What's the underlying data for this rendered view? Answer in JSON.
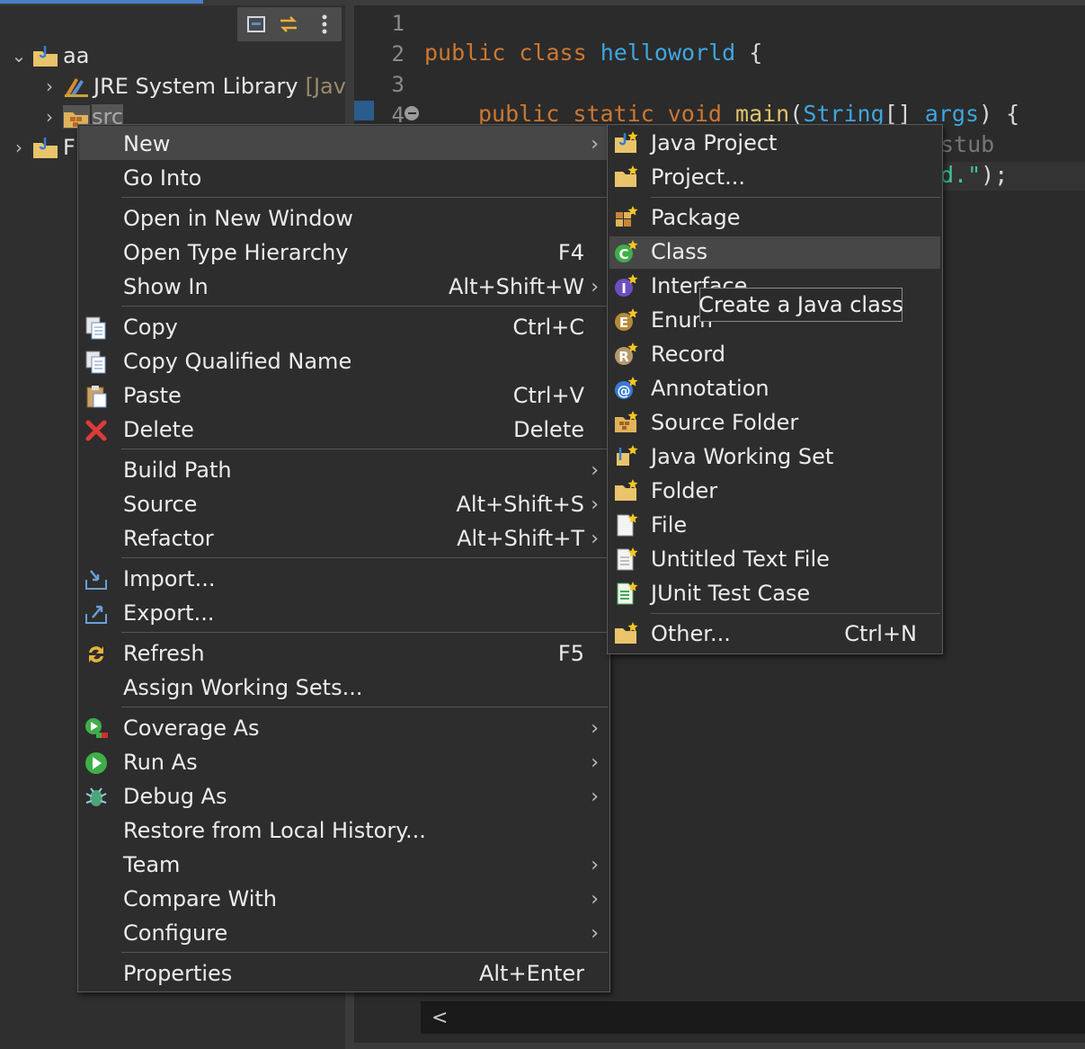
{
  "explorer": {
    "tree": [
      {
        "label": "aa",
        "expanded": true
      },
      {
        "label": "JRE System Library",
        "suffix": "[Java"
      },
      {
        "label": "src"
      },
      {
        "label": "F"
      }
    ]
  },
  "editor": {
    "line_numbers": [
      "1",
      "2",
      "3",
      "4"
    ],
    "code": {
      "l2_kw1": "public",
      "l2_kw2": "class",
      "l2_name": "helloworld",
      "l2_brace": "{",
      "l4_kw1": "public",
      "l4_kw2": "static",
      "l4_kw3": "void",
      "l4_fn": "main",
      "l4_paren": "(",
      "l4_type": "String",
      "l4_arr": "[]",
      "l4_arg": "args",
      "l4_end": ") {",
      "l5_tail": "stub",
      "l6_str": "d.\"",
      "l6_end": ");"
    },
    "hscroll_arrow": "<"
  },
  "context_menu": {
    "items": [
      {
        "label": "New",
        "shortcut": "",
        "submenu": true,
        "icon": ""
      },
      {
        "label": "Go Into",
        "shortcut": "",
        "submenu": false,
        "icon": ""
      },
      {
        "label": "Open in New Window",
        "shortcut": "",
        "submenu": false,
        "icon": ""
      },
      {
        "label": "Open Type Hierarchy",
        "shortcut": "F4",
        "submenu": false,
        "icon": ""
      },
      {
        "label": "Show In",
        "shortcut": "Alt+Shift+W",
        "submenu": true,
        "icon": ""
      },
      {
        "label": "Copy",
        "shortcut": "Ctrl+C",
        "submenu": false,
        "icon": "copy-icon"
      },
      {
        "label": "Copy Qualified Name",
        "shortcut": "",
        "submenu": false,
        "icon": "copy-qualified-icon"
      },
      {
        "label": "Paste",
        "shortcut": "Ctrl+V",
        "submenu": false,
        "icon": "paste-icon"
      },
      {
        "label": "Delete",
        "shortcut": "Delete",
        "submenu": false,
        "icon": "delete-icon"
      },
      {
        "label": "Build Path",
        "shortcut": "",
        "submenu": true,
        "icon": ""
      },
      {
        "label": "Source",
        "shortcut": "Alt+Shift+S",
        "submenu": true,
        "icon": ""
      },
      {
        "label": "Refactor",
        "shortcut": "Alt+Shift+T",
        "submenu": true,
        "icon": ""
      },
      {
        "label": "Import...",
        "shortcut": "",
        "submenu": false,
        "icon": "import-icon"
      },
      {
        "label": "Export...",
        "shortcut": "",
        "submenu": false,
        "icon": "export-icon"
      },
      {
        "label": "Refresh",
        "shortcut": "F5",
        "submenu": false,
        "icon": "refresh-icon"
      },
      {
        "label": "Assign Working Sets...",
        "shortcut": "",
        "submenu": false,
        "icon": ""
      },
      {
        "label": "Coverage As",
        "shortcut": "",
        "submenu": true,
        "icon": "coverage-icon"
      },
      {
        "label": "Run As",
        "shortcut": "",
        "submenu": true,
        "icon": "run-icon"
      },
      {
        "label": "Debug As",
        "shortcut": "",
        "submenu": true,
        "icon": "debug-icon"
      },
      {
        "label": "Restore from Local History...",
        "shortcut": "",
        "submenu": false,
        "icon": ""
      },
      {
        "label": "Team",
        "shortcut": "",
        "submenu": true,
        "icon": ""
      },
      {
        "label": "Compare With",
        "shortcut": "",
        "submenu": true,
        "icon": ""
      },
      {
        "label": "Configure",
        "shortcut": "",
        "submenu": true,
        "icon": ""
      },
      {
        "label": "Properties",
        "shortcut": "Alt+Enter",
        "submenu": false,
        "icon": ""
      }
    ]
  },
  "new_submenu": {
    "items": [
      {
        "label": "Java Project",
        "shortcut": "",
        "icon": "java-project-icon"
      },
      {
        "label": "Project...",
        "shortcut": "",
        "icon": "project-icon"
      },
      {
        "label": "Package",
        "shortcut": "",
        "icon": "package-icon"
      },
      {
        "label": "Class",
        "shortcut": "",
        "icon": "class-icon"
      },
      {
        "label": "Interface",
        "shortcut": "",
        "icon": "interface-icon"
      },
      {
        "label": "Enum",
        "shortcut": "",
        "icon": "enum-icon"
      },
      {
        "label": "Record",
        "shortcut": "",
        "icon": "record-icon"
      },
      {
        "label": "Annotation",
        "shortcut": "",
        "icon": "annotation-icon"
      },
      {
        "label": "Source Folder",
        "shortcut": "",
        "icon": "source-folder-icon"
      },
      {
        "label": "Java Working Set",
        "shortcut": "",
        "icon": "working-set-icon"
      },
      {
        "label": "Folder",
        "shortcut": "",
        "icon": "folder-icon"
      },
      {
        "label": "File",
        "shortcut": "",
        "icon": "file-icon"
      },
      {
        "label": "Untitled Text File",
        "shortcut": "",
        "icon": "text-file-icon"
      },
      {
        "label": "JUnit Test Case",
        "shortcut": "",
        "icon": "junit-icon"
      },
      {
        "label": "Other...",
        "shortcut": "Ctrl+N",
        "icon": "other-icon"
      }
    ]
  },
  "tooltip": {
    "text": "Create a Java class"
  },
  "colors": {
    "keyword": "#cc7832",
    "class_name": "#3fa6e0",
    "menu_bg": "#2d2d2d",
    "highlight": "#474747"
  }
}
